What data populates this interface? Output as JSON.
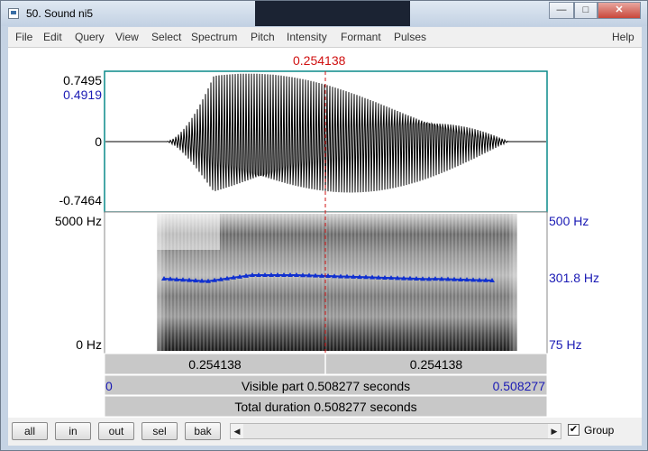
{
  "window": {
    "title": "50. Sound ni5",
    "controls": {
      "minimize": "—",
      "maximize": "□",
      "close": "✕"
    }
  },
  "menu": [
    "File",
    "Edit",
    "Query",
    "View",
    "Select",
    "Spectrum",
    "Pitch",
    "Intensity",
    "Formant",
    "Pulses",
    "Help"
  ],
  "cursor_time": "0.254138",
  "waveform": {
    "ticks": {
      "max": "0.7495",
      "value": "0.4919",
      "zero": "0",
      "min": "-0.7464"
    }
  },
  "spectrogram": {
    "freq_top": "5000 Hz",
    "freq_bottom": "0 Hz",
    "pitch_top": "500 Hz",
    "pitch_value": "301.8 Hz",
    "pitch_bottom": "75 Hz"
  },
  "time_bars": {
    "left": "0.254138",
    "right": "0.254138",
    "visible_start": "0",
    "visible_label": "Visible part 0.508277 seconds",
    "visible_end": "0.508277",
    "total_label": "Total duration 0.508277 seconds"
  },
  "buttons": {
    "all": "all",
    "in": "in",
    "out": "out",
    "sel": "sel",
    "bak": "bak"
  },
  "group": {
    "label": "Group",
    "checked": "✔"
  },
  "colors": {
    "pitch": "#1030d0",
    "cursor": "#d01010",
    "accent_blue": "#1a1ab4"
  }
}
